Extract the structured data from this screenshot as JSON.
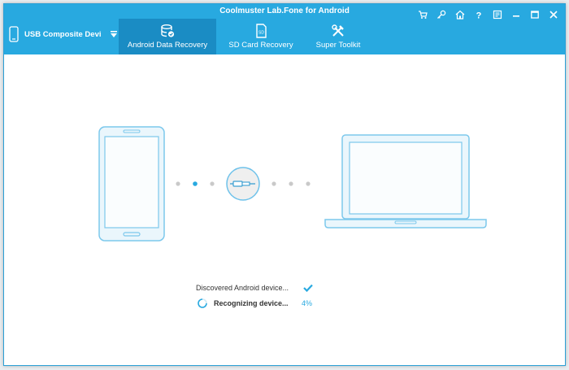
{
  "window": {
    "title": "Coolmuster Lab.Fone for Android"
  },
  "device": {
    "label": "USB  Composite Devi",
    "icon": "phone-icon"
  },
  "tabs": [
    {
      "label": "Android Data Recovery",
      "icon": "database-recovery-icon",
      "active": true
    },
    {
      "label": "SD Card Recovery",
      "icon": "sd-card-icon",
      "active": false
    },
    {
      "label": "Super Toolkit",
      "icon": "tools-icon",
      "active": false
    }
  ],
  "title_buttons": [
    "cart-icon",
    "key-icon",
    "home-icon",
    "help-icon",
    "feedback-icon",
    "minimize-icon",
    "maximize-icon",
    "close-icon"
  ],
  "status": {
    "discovered": "Discovered Android device...",
    "recognizing": "Recognizing device...",
    "progress": "4%"
  },
  "colors": {
    "accent": "#28a9e0",
    "active_tab": "#1a8cc4",
    "outline": "#6fc2ea"
  }
}
